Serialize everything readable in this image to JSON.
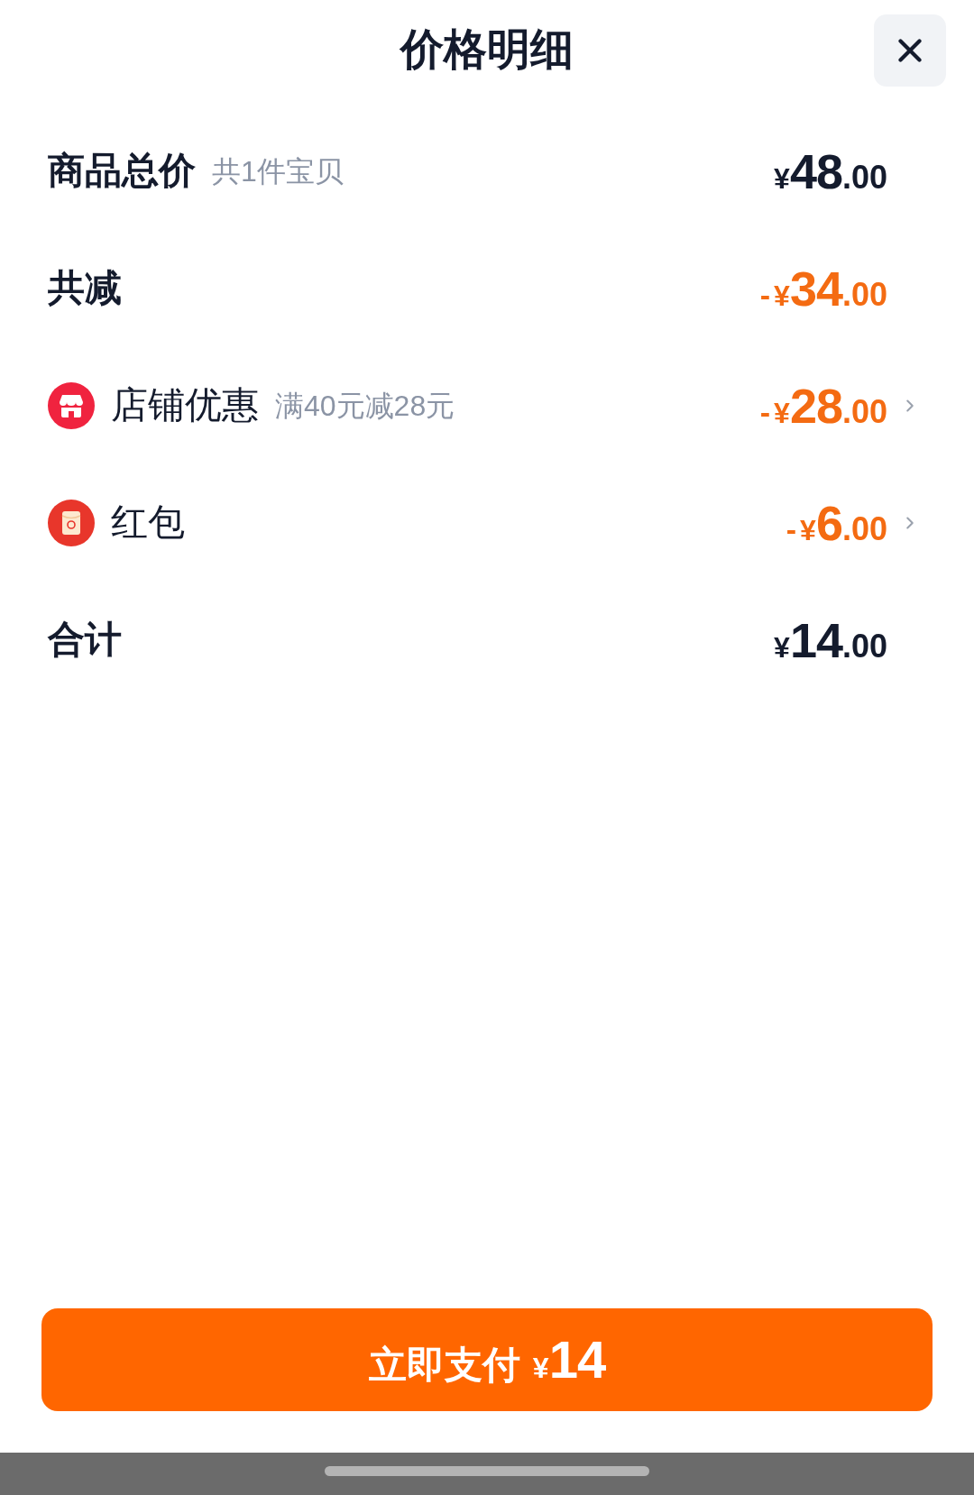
{
  "header": {
    "title": "价格明细"
  },
  "rows": [
    {
      "kind": "subtotal",
      "label": "商品总价",
      "note": "共1件宝贝",
      "price": {
        "currency": "¥",
        "integer": "48",
        "fraction": ".00"
      }
    },
    {
      "kind": "reduction",
      "label": "共减",
      "price": {
        "sign": "-",
        "currency": "¥",
        "integer": "34",
        "fraction": ".00"
      }
    },
    {
      "kind": "shop_coupon",
      "label": "店铺优惠",
      "note": "满40元减28元",
      "price": {
        "sign": "-",
        "currency": "¥",
        "integer": "28",
        "fraction": ".00"
      }
    },
    {
      "kind": "red_packet",
      "label": "红包",
      "price": {
        "sign": "-",
        "currency": "¥",
        "integer": "6",
        "fraction": ".00"
      }
    },
    {
      "kind": "total",
      "label": "合计",
      "price": {
        "currency": "¥",
        "integer": "14",
        "fraction": ".00"
      }
    }
  ],
  "pay_button": {
    "label": "立即支付",
    "currency": "¥",
    "amount": "14"
  }
}
